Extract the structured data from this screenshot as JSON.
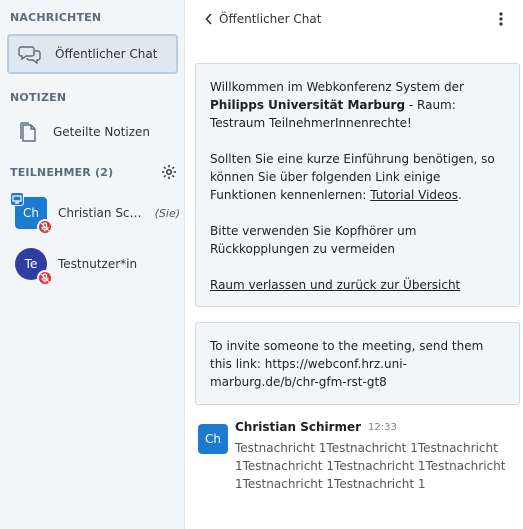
{
  "sidebar": {
    "messages_section": "NACHRICHTEN",
    "public_chat_label": "Öffentlicher Chat",
    "notes_section": "NOTIZEN",
    "shared_notes_label": "Geteilte Notizen",
    "participants_section": "TEILNEHMER (2)",
    "users": [
      {
        "initials": "Ch",
        "name": "Christian Schirmer",
        "you_label": "(Sie)"
      },
      {
        "initials": "Te",
        "name": "Testnutzer*in"
      }
    ]
  },
  "chat": {
    "title": "Öffentlicher Chat",
    "welcome": {
      "line1_prefix": "Willkommen im Webkonferenz System der ",
      "university": "Philipps Universität Marburg",
      "line1_suffix": " - Raum: Testraum TeilnehmerInnenrechte!",
      "intro_prefix": "Sollten Sie eine kurze Einführung benötigen, so können Sie über folgenden Link einige Funktionen kennenlernen: ",
      "tutorial_link": "Tutorial Videos",
      "intro_suffix": ".",
      "headphones": "Bitte verwenden Sie Kopfhörer um Rückkopplungen zu vermeiden",
      "leave_link": "Raum verlassen und zurück zur Übersicht"
    },
    "invite": "To invite someone to the meeting, send them this link: https://webconf.hrz.uni-marburg.de/b/chr-gfm-rst-gt8",
    "messages": [
      {
        "initials": "Ch",
        "author": "Christian Schirmer",
        "time": "12:33",
        "text": "Testnachricht 1Testnachricht 1Testnachricht 1Testnachricht 1Testnachricht 1Testnachricht 1Testnachricht 1Testnachricht 1"
      }
    ]
  },
  "colors": {
    "sidebar_bg": "#f3f6f9",
    "active_border": "#b9cbe0",
    "avatar_blue": "#1c7bd1",
    "avatar_indigo": "#2f3ea1",
    "muted_red": "#d9363e"
  },
  "icons": {
    "public_chat": "chat-bubbles-icon",
    "shared_notes": "document-icon",
    "settings": "gear-icon",
    "back": "chevron-left-icon",
    "more": "kebab-menu-icon",
    "muted_mic": "muted-mic-icon",
    "presenter": "presentation-screen-icon"
  }
}
